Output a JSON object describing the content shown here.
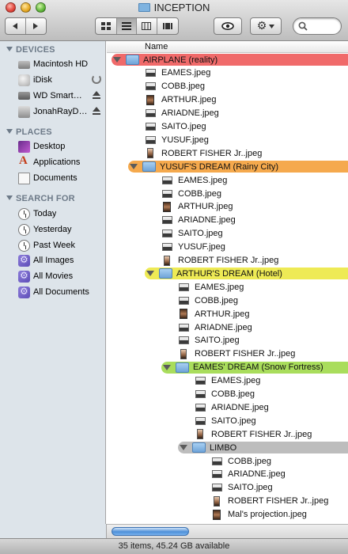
{
  "window": {
    "title": "INCEPTION",
    "status": "35 items, 45.24 GB available"
  },
  "sidebar": {
    "devices_label": "DEVICES",
    "places_label": "PLACES",
    "search_label": "SEARCH FOR",
    "devices": [
      {
        "label": "Macintosh HD",
        "icon": "hard-drive-icon"
      },
      {
        "label": "iDisk",
        "icon": "idisk-icon"
      },
      {
        "label": "WD Smart…",
        "icon": "external-drive-icon"
      },
      {
        "label": "JonahRayD…",
        "icon": "network-drive-icon"
      }
    ],
    "places": [
      {
        "label": "Desktop",
        "icon": "desktop-icon"
      },
      {
        "label": "Applications",
        "icon": "applications-icon"
      },
      {
        "label": "Documents",
        "icon": "documents-icon"
      }
    ],
    "search": [
      {
        "label": "Today",
        "icon": "clock-icon"
      },
      {
        "label": "Yesterday",
        "icon": "clock-icon"
      },
      {
        "label": "Past Week",
        "icon": "clock-icon"
      },
      {
        "label": "All Images",
        "icon": "smart-folder-icon"
      },
      {
        "label": "All Movies",
        "icon": "smart-folder-icon"
      },
      {
        "label": "All Documents",
        "icon": "smart-folder-icon"
      }
    ]
  },
  "list": {
    "column_name": "Name",
    "label_colors": {
      "red": "#f06a6a",
      "orange": "#f5a94d",
      "yellow": "#eeea55",
      "green": "#a9dd5c",
      "gray": "#bdbdbd"
    },
    "rows": [
      {
        "name": "AIRPLANE (reality)",
        "kind": "folder",
        "level": 0,
        "label": "red"
      },
      {
        "name": "EAMES.jpeg",
        "kind": "img",
        "level": 0
      },
      {
        "name": "COBB.jpeg",
        "kind": "img",
        "level": 0
      },
      {
        "name": "ARTHUR.jpeg",
        "kind": "photo",
        "level": 0
      },
      {
        "name": "ARIADNE.jpeg",
        "kind": "img",
        "level": 0
      },
      {
        "name": "SAITO.jpeg",
        "kind": "img",
        "level": 0
      },
      {
        "name": "YUSUF.jpeg",
        "kind": "img",
        "level": 0
      },
      {
        "name": "ROBERT FISHER Jr..jpeg",
        "kind": "portrait",
        "level": 0
      },
      {
        "name": "YUSUF'S DREAM (Rainy City)",
        "kind": "folder",
        "level": 1,
        "label": "orange"
      },
      {
        "name": "EAMES.jpeg",
        "kind": "img",
        "level": 1
      },
      {
        "name": "COBB.jpeg",
        "kind": "img",
        "level": 1
      },
      {
        "name": "ARTHUR.jpeg",
        "kind": "photo",
        "level": 1
      },
      {
        "name": "ARIADNE.jpeg",
        "kind": "img",
        "level": 1
      },
      {
        "name": "SAITO.jpeg",
        "kind": "img",
        "level": 1
      },
      {
        "name": "YUSUF.jpeg",
        "kind": "img",
        "level": 1
      },
      {
        "name": "ROBERT FISHER Jr..jpeg",
        "kind": "portrait",
        "level": 1
      },
      {
        "name": "ARTHUR'S DREAM (Hotel)",
        "kind": "folder",
        "level": 2,
        "label": "yellow"
      },
      {
        "name": "EAMES.jpeg",
        "kind": "img",
        "level": 2
      },
      {
        "name": "COBB.jpeg",
        "kind": "img",
        "level": 2
      },
      {
        "name": "ARTHUR.jpeg",
        "kind": "photo",
        "level": 2
      },
      {
        "name": "ARIADNE.jpeg",
        "kind": "img",
        "level": 2
      },
      {
        "name": "SAITO.jpeg",
        "kind": "img",
        "level": 2
      },
      {
        "name": "ROBERT FISHER Jr..jpeg",
        "kind": "portrait",
        "level": 2
      },
      {
        "name": "EAMES' DREAM (Snow Fortress)",
        "kind": "folder",
        "level": 3,
        "label": "green"
      },
      {
        "name": "EAMES.jpeg",
        "kind": "img",
        "level": 3
      },
      {
        "name": "COBB.jpeg",
        "kind": "img",
        "level": 3
      },
      {
        "name": "ARIADNE.jpeg",
        "kind": "img",
        "level": 3
      },
      {
        "name": "SAITO.jpeg",
        "kind": "img",
        "level": 3
      },
      {
        "name": "ROBERT FISHER Jr..jpeg",
        "kind": "portrait",
        "level": 3
      },
      {
        "name": "LIMBO",
        "kind": "folder",
        "level": 4,
        "label": "gray"
      },
      {
        "name": "COBB.jpeg",
        "kind": "img",
        "level": 4
      },
      {
        "name": "ARIADNE.jpeg",
        "kind": "img",
        "level": 4
      },
      {
        "name": "SAITO.jpeg",
        "kind": "img",
        "level": 4
      },
      {
        "name": "ROBERT FISHER Jr..jpeg",
        "kind": "portrait",
        "level": 4
      },
      {
        "name": "Mal's projection.jpeg",
        "kind": "photo",
        "level": 4
      }
    ]
  }
}
